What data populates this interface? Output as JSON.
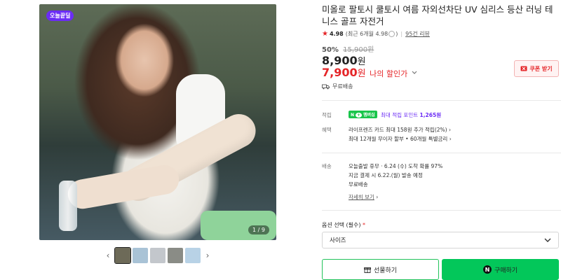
{
  "gallery": {
    "badge": "오늘끝딜",
    "counter": "1 / 9",
    "prev_arrow": "‹",
    "next_arrow": "›",
    "thumbnail_colors": [
      "#6d6a58",
      "#a9c3d6",
      "#c3c7cc",
      "#8a8c86",
      "#b8d2e6"
    ]
  },
  "product": {
    "title": "미올로 팔토시 쿨토시 여름 자외선차단 UV 심리스 등산 러닝 테니스 골프 자전거",
    "rating": {
      "star_icon": "★",
      "score": "4.98",
      "recent": "(최근 6개월 4.98",
      "recent_close": ")",
      "reviews": "95건 리뷰"
    },
    "discount_rate": "50%",
    "original_price": "15,900원",
    "price": "8,900",
    "price_unit": "원",
    "my_price": "7,900",
    "my_price_unit": "원",
    "my_price_label": "나의 할인가",
    "coupon_button": "쿠폰 받기",
    "shipping": "무료배송"
  },
  "benefits": {
    "points_label": "적립",
    "npay_text": "N",
    "npay_suffix": "멤버십",
    "points_text": "최대 적립 포인트",
    "points_value": "1,265원",
    "promo_label": "혜택",
    "promo_line1": "라이프렌즈 카드 최대 158원 추가 적립(2%)",
    "promo_line2": "최대 12개월 무이자 할부 • 60개월 특별금리"
  },
  "delivery": {
    "label": "배송",
    "line1": "오늘출발 휴무 · 6.24 (수) 도착 확률 97%",
    "line2": "지금 결제 시 6.22.(월) 발송 예정",
    "line3": "무료배송",
    "more": "자세히 보기"
  },
  "options": {
    "label": "옵션 선택 (필수)",
    "required_mark": "*",
    "select_value": "사이즈"
  },
  "actions": {
    "gift": "선물하기",
    "buy": "구매하기",
    "buy_icon": "N"
  },
  "colors": {
    "accent_red": "#e52528",
    "naver_green": "#03c75a",
    "badge_purple": "#6b2cf5"
  }
}
